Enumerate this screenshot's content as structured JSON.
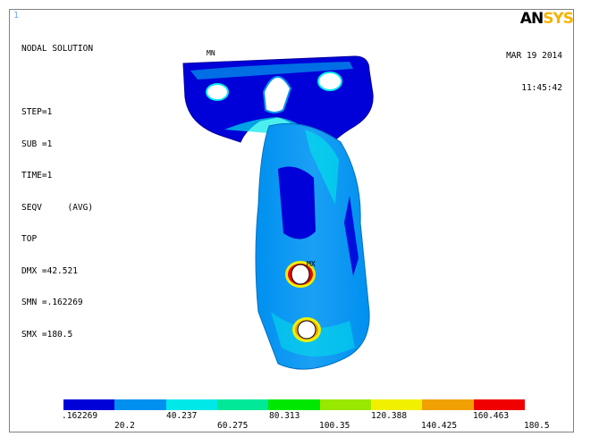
{
  "window_number": "1",
  "brand": {
    "part1": "AN",
    "part2": "SYS"
  },
  "info_lines": [
    "NODAL SOLUTION",
    "",
    "STEP=1",
    "SUB =1",
    "TIME=1",
    "SEQV     (AVG)",
    "TOP",
    "DMX =42.521",
    "SMN =.162269",
    "SMX =180.5"
  ],
  "date": "MAR 19 2014",
  "time": "11:45:42",
  "markers": {
    "min": "MN",
    "max": "MX"
  },
  "legend": {
    "colors": [
      "#0000d8",
      "#0090f0",
      "#00e8e8",
      "#00e898",
      "#00e800",
      "#98e800",
      "#f0f000",
      "#f0a000",
      "#f00000"
    ],
    "labels_top": [
      ".162269",
      "40.237",
      "80.313",
      "120.388",
      "160.463"
    ],
    "labels_bottom": [
      "20.2",
      "60.275",
      "100.35",
      "140.425",
      "180.5"
    ]
  }
}
